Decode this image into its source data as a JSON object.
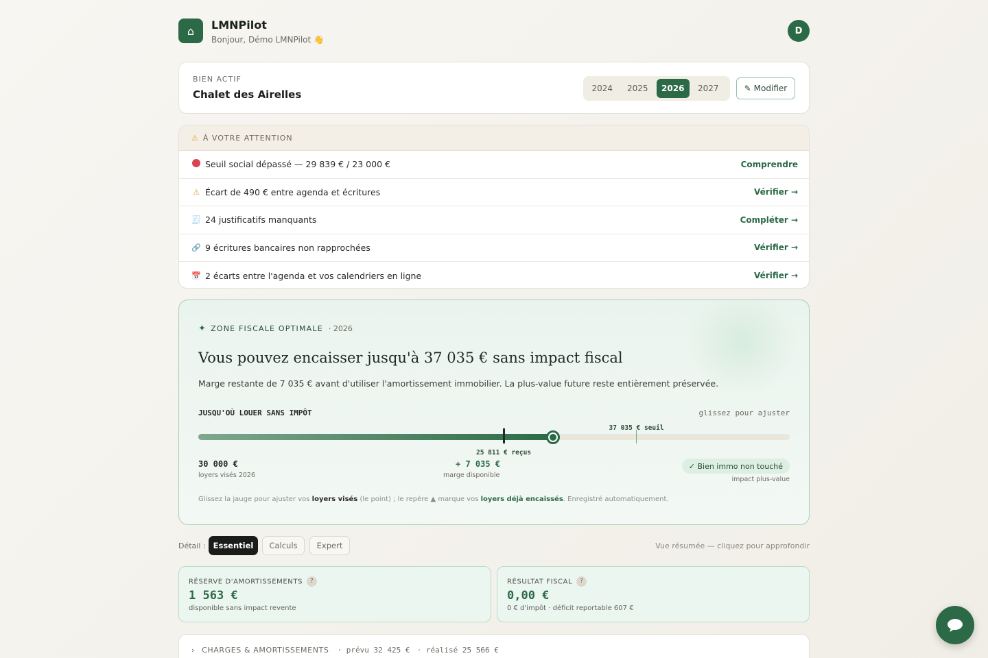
{
  "header": {
    "logo_glyph": "⌂",
    "app_name": "LMNPilot",
    "greeting": "Bonjour, Démo LMNPilot 👋",
    "avatar_initial": "D"
  },
  "bien": {
    "label": "BIEN ACTIF",
    "name": "Chalet des Airelles",
    "years": [
      "2024",
      "2025",
      "2026",
      "2027"
    ],
    "selected_year": "2026",
    "modify_label": "✎ Modifier"
  },
  "attention": {
    "title": "À VOTRE ATTENTION",
    "title_icon": "warning-icon",
    "items": [
      {
        "icon": "red-dot-icon",
        "text": "Seuil social dépassé — 29 839 € / 23 000 €",
        "action": "Comprendre"
      },
      {
        "icon": "warning-icon",
        "glyph": "⚠",
        "text": "Écart de 490 € entre agenda et écritures",
        "action": "Vérifier →"
      },
      {
        "icon": "receipt-icon",
        "glyph": "🧾",
        "text": "24 justificatifs manquants",
        "action": "Compléter →"
      },
      {
        "icon": "link-icon",
        "glyph": "🔗",
        "text": "9 écritures bancaires non rapprochées",
        "action": "Vérifier →"
      },
      {
        "icon": "calendar-icon",
        "glyph": "📅",
        "text": "2 écarts entre l'agenda et vos calendriers en ligne",
        "action": "Vérifier →"
      }
    ]
  },
  "zone": {
    "tag": "ZONE FISCALE OPTIMALE",
    "tag_icon": "sparkle-icon",
    "year": "· 2026",
    "title": "Vous pouvez encaisser jusqu'à 37 035 € sans impact fiscal",
    "subtitle": "Marge restante de 7 035 € avant d'utiliser l'amortissement immobilier. La plus-value future reste entièrement préservée.",
    "gauge_label": "JUSQU'OÙ LOUER SANS IMPÔT",
    "gauge_hint": "glissez pour ajuster",
    "gauge": {
      "min": 0,
      "max": 50000,
      "target": 30000,
      "received": 25811,
      "threshold": 37035
    },
    "seuil_text": "37 035 € seuil",
    "recu_text": "25 811 € reçus",
    "loyers_value": "30 000 €",
    "loyers_label": "loyers visés 2026",
    "marge_value": "+ 7 035 €",
    "marge_label": "marge disponible",
    "badge": "✓ Bien immo non touché",
    "badge_sub": "impact plus-value",
    "foot_1": "Glissez la jauge pour ajuster vos ",
    "foot_b1": "loyers visés",
    "foot_2": " (le point) ; le repère ▲ marque vos ",
    "foot_b2": "loyers déjà encaissés",
    "foot_3": ". Enregistré automatiquement."
  },
  "detail": {
    "label": "Détail :",
    "options": [
      "Essentiel",
      "Calculs",
      "Expert"
    ],
    "selected": "Essentiel",
    "hint": "Vue résumée — cliquez pour approfondir"
  },
  "stats": [
    {
      "title": "RÉSERVE D'AMORTISSEMENTS",
      "value": "1 563 €",
      "sub": "disponible sans impact revente"
    },
    {
      "title": "RÉSULTAT FISCAL",
      "value": "0,00 €",
      "sub": "0 € d'impôt · déficit reportable 607 €"
    }
  ],
  "charges": {
    "arrow": "›",
    "title": "CHARGES & AMORTISSEMENTS",
    "prevu": "· prévu 32 425 €",
    "realise": "· réalisé 25 566 €"
  },
  "colors": {
    "accent": "#2c6a47",
    "danger": "#d94354",
    "warning": "#e2a12a"
  }
}
